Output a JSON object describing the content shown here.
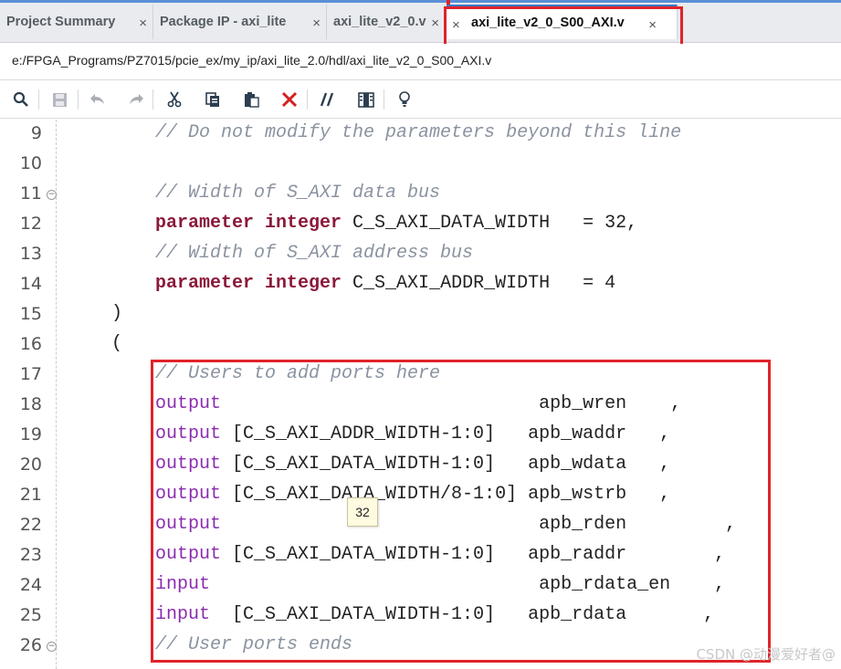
{
  "tabs": [
    {
      "label": "Project Summary",
      "close": "×"
    },
    {
      "label": "Package IP - axi_lite",
      "close": "×"
    },
    {
      "label": "axi_lite_v2_0.v",
      "close": "×"
    },
    {
      "label": "axi_lite_v2_0_S00_AXI.v",
      "close": "×",
      "close_left": "×"
    }
  ],
  "path": "e:/FPGA_Programs/PZ7015/pcie_ex/my_ip/axi_lite_2.0/hdl/axi_lite_v2_0_S00_AXI.v",
  "toolbar": {
    "icons": [
      "search-icon",
      "save-icon",
      "undo-icon",
      "redo-icon",
      "cut-icon",
      "copy-icon",
      "paste-icon",
      "delete-icon",
      "comment-icon",
      "columns-icon",
      "lightbulb-icon"
    ],
    "glyphs": {
      "search": "🔍︎",
      "save": "▦",
      "undo": "↶",
      "redo": "↷",
      "cut": "✂",
      "copy": "⧉",
      "paste": "▤",
      "delete": "✕",
      "comment": "//",
      "columns": "▥",
      "lightbulb": "♀"
    }
  },
  "editor": {
    "lines": [
      {
        "num": "9",
        "fold": false,
        "segments": [
          {
            "cls": "cmt",
            "indent": 8,
            "text": "// Do not modify the parameters beyond this line"
          }
        ]
      },
      {
        "num": "10",
        "fold": false,
        "segments": []
      },
      {
        "num": "11",
        "fold": true,
        "segments": [
          {
            "cls": "cmt",
            "indent": 8,
            "text": "// Width of S_AXI data bus"
          }
        ]
      },
      {
        "num": "12",
        "fold": false,
        "segments": [
          {
            "cls": "kw",
            "indent": 8,
            "text": "parameter integer"
          },
          {
            "cls": "plain",
            "text": " C_S_AXI_DATA_WIDTH   = 32,"
          }
        ]
      },
      {
        "num": "13",
        "fold": false,
        "segments": [
          {
            "cls": "cmt",
            "indent": 8,
            "text": "// Width of S_AXI address bus"
          }
        ]
      },
      {
        "num": "14",
        "fold": false,
        "segments": [
          {
            "cls": "kw",
            "indent": 8,
            "text": "parameter integer"
          },
          {
            "cls": "plain",
            "text": " C_S_AXI_ADDR_WIDTH   = 4"
          }
        ]
      },
      {
        "num": "15",
        "fold": false,
        "segments": [
          {
            "cls": "plain",
            "indent": 4,
            "text": ")"
          }
        ]
      },
      {
        "num": "16",
        "fold": false,
        "segments": [
          {
            "cls": "plain",
            "indent": 4,
            "text": "("
          }
        ]
      },
      {
        "num": "17",
        "fold": false,
        "segments": [
          {
            "cls": "cmt",
            "indent": 8,
            "text": "// Users to add ports here"
          }
        ]
      },
      {
        "num": "18",
        "fold": false,
        "segments": [
          {
            "cls": "port",
            "indent": 8,
            "text": "output"
          },
          {
            "cls": "plain",
            "text": "                             apb_wren    ,"
          }
        ]
      },
      {
        "num": "19",
        "fold": false,
        "segments": [
          {
            "cls": "port",
            "indent": 8,
            "text": "output"
          },
          {
            "cls": "plain",
            "text": " [C_S_AXI_ADDR_WIDTH-1:0]   apb_waddr   ,"
          }
        ]
      },
      {
        "num": "20",
        "fold": false,
        "segments": [
          {
            "cls": "port",
            "indent": 8,
            "text": "output"
          },
          {
            "cls": "plain",
            "text": " [C_S_AXI_DATA_WIDTH-1:0]   apb_wdata   ,"
          }
        ]
      },
      {
        "num": "21",
        "fold": false,
        "segments": [
          {
            "cls": "port",
            "indent": 8,
            "text": "output"
          },
          {
            "cls": "plain",
            "text": " [C_S_AXI_DATA_WIDTH/8-1:0] apb_wstrb   ,"
          }
        ]
      },
      {
        "num": "22",
        "fold": false,
        "segments": [
          {
            "cls": "port",
            "indent": 8,
            "text": "output"
          },
          {
            "cls": "plain",
            "text": "                             apb_rden         ,"
          }
        ]
      },
      {
        "num": "23",
        "fold": false,
        "segments": [
          {
            "cls": "port",
            "indent": 8,
            "text": "output"
          },
          {
            "cls": "plain",
            "text": " [C_S_AXI_DATA_WIDTH-1:0]   apb_raddr        ,"
          }
        ]
      },
      {
        "num": "24",
        "fold": false,
        "segments": [
          {
            "cls": "port",
            "indent": 8,
            "text": "input"
          },
          {
            "cls": "plain",
            "text": "                              apb_rdata_en    ,"
          }
        ]
      },
      {
        "num": "25",
        "fold": false,
        "segments": [
          {
            "cls": "port",
            "indent": 8,
            "text": "input"
          },
          {
            "cls": "plain",
            "text": "  [C_S_AXI_DATA_WIDTH-1:0]   apb_rdata       ,"
          }
        ]
      },
      {
        "num": "26",
        "fold": true,
        "segments": [
          {
            "cls": "cmt",
            "indent": 8,
            "text": "// User ports ends"
          }
        ]
      }
    ],
    "tooltip": "32"
  },
  "watermark": "CSDN @动漫爱好者@"
}
